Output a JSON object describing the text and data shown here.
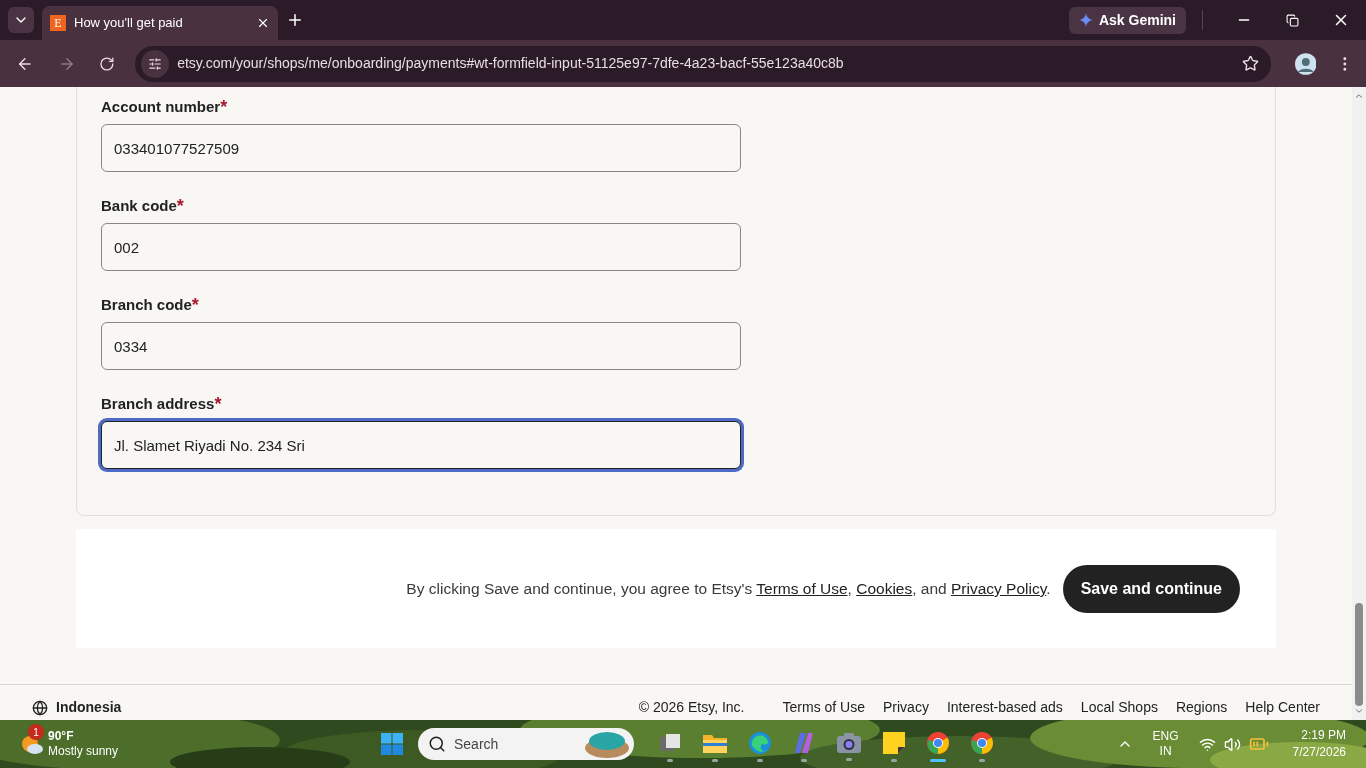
{
  "browser": {
    "tabs": [
      {
        "favicon": "E",
        "title": "How you'll get paid",
        "selected": true
      }
    ],
    "ask_button": "Ask Gemini",
    "url": "etsy.com/your/shops/me/onboarding/payments#wt-formfield-input-51125e97-7dfe-4a23-bacf-55e123a40c8b"
  },
  "form": {
    "fields": [
      {
        "label": "Account number",
        "required_mark": "*",
        "value": "033401077527509",
        "focused": false
      },
      {
        "label": "Bank code",
        "required_mark": "*",
        "value": "002",
        "focused": false
      },
      {
        "label": "Branch code",
        "required_mark": "*",
        "value": "0334",
        "focused": false
      },
      {
        "label": "Branch address",
        "required_mark": "*",
        "value": "Jl. Slamet Riyadi No. 234 Sri",
        "focused": true
      }
    ]
  },
  "consent": [
    {
      "kind": "text",
      "text": "By clicking Save and continue, you agree to Etsy's "
    },
    {
      "kind": "link",
      "text": "Terms of Use"
    },
    {
      "kind": "text",
      "text": ", "
    },
    {
      "kind": "link",
      "text": "Cookies"
    },
    {
      "kind": "text",
      "text": ", and "
    },
    {
      "kind": "link",
      "text": "Privacy Policy"
    },
    {
      "kind": "text",
      "text": "."
    }
  ],
  "save_button": "Save and continue",
  "footer": {
    "region": "Indonesia",
    "copyright": "© 2026 Etsy, Inc.",
    "links": [
      "Terms of Use",
      "Privacy",
      "Interest-based ads",
      "Local Shops",
      "Regions",
      "Help Center"
    ]
  },
  "taskbar": {
    "weather": {
      "badge": "1",
      "temperature": "90°F",
      "condition": "Mostly sunny"
    },
    "search_placeholder": "Search",
    "apps": [
      {
        "kind": "task-view",
        "active": false
      },
      {
        "kind": "folder",
        "active": false
      },
      {
        "kind": "edge",
        "active": false
      },
      {
        "kind": "copilot",
        "active": false
      },
      {
        "kind": "camera",
        "active": false
      },
      {
        "kind": "sticky-notes",
        "active": false
      },
      {
        "kind": "chrome",
        "active": true
      },
      {
        "kind": "chrome",
        "active": false
      }
    ],
    "language": "ENG",
    "input_region": "IN",
    "time": "2:19 PM",
    "date": "7/27/2026"
  }
}
